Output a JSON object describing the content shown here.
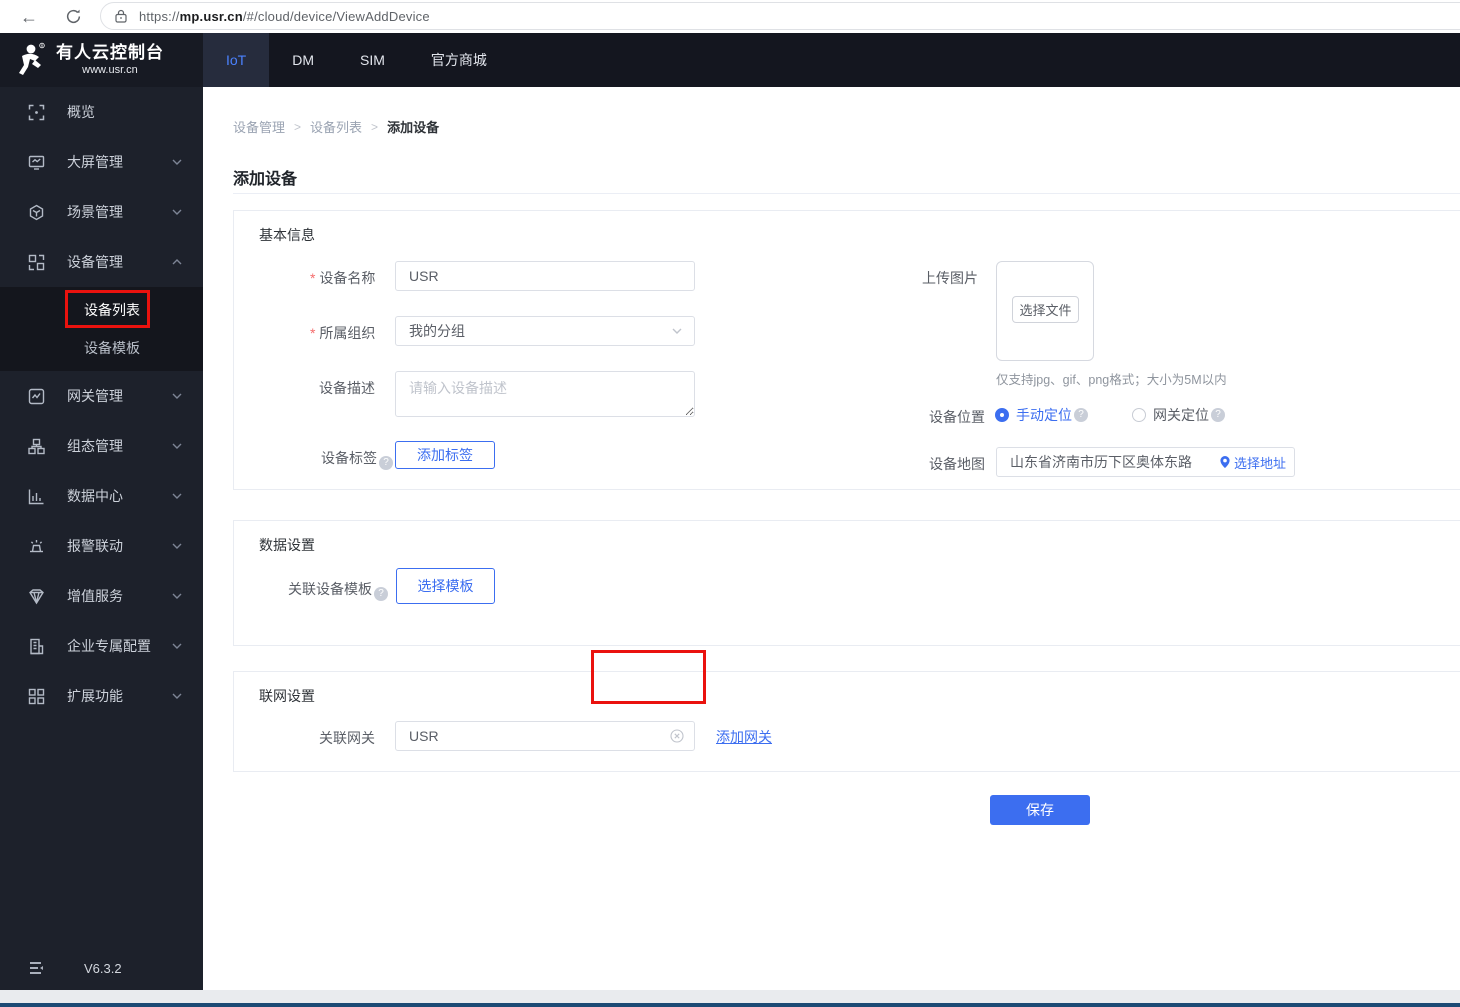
{
  "browser": {
    "url_scheme": "https://",
    "url_host": "mp.usr.cn",
    "url_path": "/#/cloud/device/ViewAddDevice"
  },
  "brand": {
    "title": "有人云控制台",
    "subtitle": "www.usr.cn"
  },
  "nav": {
    "tabs": [
      {
        "label": "IoT",
        "active": true
      },
      {
        "label": "DM",
        "active": false
      },
      {
        "label": "SIM",
        "active": false
      },
      {
        "label": "官方商城",
        "active": false
      }
    ]
  },
  "sidebar": {
    "items": [
      {
        "label": "概览",
        "icon": "overview-icon"
      },
      {
        "label": "大屏管理",
        "icon": "screen-icon",
        "chevron": "down"
      },
      {
        "label": "场景管理",
        "icon": "scene-icon",
        "chevron": "down"
      },
      {
        "label": "设备管理",
        "icon": "device-icon",
        "chevron": "up",
        "expanded": true
      },
      {
        "label": "网关管理",
        "icon": "gateway-icon",
        "chevron": "down"
      },
      {
        "label": "组态管理",
        "icon": "scada-icon",
        "chevron": "down"
      },
      {
        "label": "数据中心",
        "icon": "data-icon",
        "chevron": "down"
      },
      {
        "label": "报警联动",
        "icon": "alarm-icon",
        "chevron": "down"
      },
      {
        "label": "增值服务",
        "icon": "vas-icon",
        "chevron": "down"
      },
      {
        "label": "企业专属配置",
        "icon": "enterprise-icon",
        "chevron": "down"
      },
      {
        "label": "扩展功能",
        "icon": "extension-icon",
        "chevron": "down"
      }
    ],
    "submenu": [
      {
        "label": "设备列表",
        "active": true,
        "highlighted": true
      },
      {
        "label": "设备模板",
        "active": false
      }
    ],
    "version": "V6.3.2"
  },
  "breadcrumb": [
    "设备管理",
    "设备列表",
    "添加设备"
  ],
  "page": {
    "title": "添加设备"
  },
  "basic_info": {
    "section_title": "基本信息",
    "device_name": {
      "label": "设备名称",
      "required": true,
      "value": "USR"
    },
    "organization": {
      "label": "所属组织",
      "required": true,
      "value": "我的分组"
    },
    "description": {
      "label": "设备描述",
      "placeholder": "请输入设备描述"
    },
    "tags": {
      "label": "设备标签",
      "button": "添加标签"
    },
    "upload": {
      "label": "上传图片",
      "button": "选择文件",
      "hint": "仅支持jpg、gif、png格式；大小为5M以内"
    },
    "location": {
      "label": "设备位置",
      "options": [
        {
          "label": "手动定位",
          "selected": true
        },
        {
          "label": "网关定位",
          "selected": false
        }
      ]
    },
    "map": {
      "label": "设备地图",
      "value": "山东省济南市历下区奥体东路",
      "link": "选择地址"
    }
  },
  "data_settings": {
    "section_title": "数据设置",
    "template": {
      "label": "关联设备模板",
      "button": "选择模板"
    }
  },
  "network_settings": {
    "section_title": "联网设置",
    "gateway": {
      "label": "关联网关",
      "value": "USR",
      "link": "添加网关"
    }
  },
  "actions": {
    "save": "保存"
  },
  "colors": {
    "accent": "#3c6ef0",
    "highlight_red": "#ea120e",
    "sidebar_bg": "#1d212b",
    "header_bg": "#14161f"
  }
}
